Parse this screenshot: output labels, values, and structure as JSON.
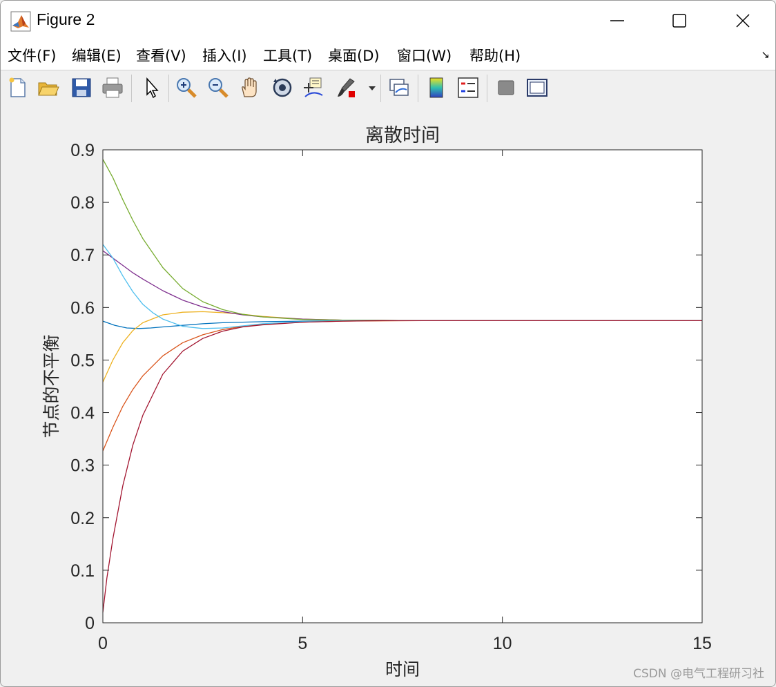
{
  "window": {
    "title": "Figure 2",
    "watermark": "CSDN @电气工程研习社"
  },
  "menu": [
    "文件(F)",
    "编辑(E)",
    "查看(V)",
    "插入(I)",
    "工具(T)",
    "桌面(D)",
    "窗口(W)",
    "帮助(H)"
  ],
  "toolbar": [
    "new-figure-icon",
    "open-file-icon",
    "save-icon",
    "print-icon",
    "pointer-icon",
    "zoom-in-icon",
    "zoom-out-icon",
    "pan-icon",
    "rotate-3d-icon",
    "data-cursor-icon",
    "brush-icon",
    "link-plot-icon",
    "colorbar-icon",
    "legend-icon",
    "hide-plot-tools-icon",
    "show-plot-tools-icon"
  ],
  "colors": {
    "blue": "#0072bd",
    "orange": "#d95319",
    "yellow": "#edb120",
    "purple": "#7e2f8e",
    "green": "#77ac30",
    "cyan": "#4dbeee",
    "darkred": "#a2142f"
  },
  "chart_data": {
    "type": "line",
    "title": "离散时间",
    "xlabel": "时间",
    "ylabel": "节点的不平衡",
    "xlim": [
      0,
      15
    ],
    "ylim": [
      0,
      0.9
    ],
    "xticks": [
      "0",
      "5",
      "10",
      "15"
    ],
    "yticks": [
      "0",
      "0.1",
      "0.2",
      "0.3",
      "0.4",
      "0.5",
      "0.6",
      "0.7",
      "0.8",
      "0.9"
    ],
    "grid": false,
    "series": [
      {
        "color": "#0072bd",
        "x": [
          0,
          0.3,
          0.6,
          0.9,
          1.2,
          1.5,
          2,
          2.5,
          3,
          4,
          5,
          6,
          8,
          10,
          15
        ],
        "y": [
          0.574,
          0.566,
          0.561,
          0.56,
          0.561,
          0.563,
          0.566,
          0.569,
          0.571,
          0.573,
          0.574,
          0.575,
          0.575,
          0.575,
          0.575
        ]
      },
      {
        "color": "#d95319",
        "x": [
          0,
          0.25,
          0.5,
          0.75,
          1,
          1.5,
          2,
          2.5,
          3,
          3.5,
          4,
          5,
          6,
          8,
          10,
          15
        ],
        "y": [
          0.327,
          0.372,
          0.412,
          0.444,
          0.47,
          0.508,
          0.533,
          0.548,
          0.558,
          0.564,
          0.568,
          0.572,
          0.574,
          0.575,
          0.575,
          0.575
        ]
      },
      {
        "color": "#edb120",
        "x": [
          0,
          0.25,
          0.5,
          0.75,
          1,
          1.5,
          2,
          2.5,
          3,
          3.5,
          4,
          5,
          6,
          8,
          10,
          15
        ],
        "y": [
          0.458,
          0.5,
          0.533,
          0.556,
          0.571,
          0.586,
          0.591,
          0.592,
          0.59,
          0.587,
          0.583,
          0.578,
          0.576,
          0.575,
          0.575,
          0.575
        ]
      },
      {
        "color": "#7e2f8e",
        "x": [
          0,
          0.25,
          0.5,
          0.75,
          1,
          1.5,
          2,
          2.5,
          3,
          3.5,
          4,
          5,
          6,
          8,
          10,
          15
        ],
        "y": [
          0.708,
          0.694,
          0.68,
          0.666,
          0.654,
          0.632,
          0.614,
          0.601,
          0.592,
          0.586,
          0.582,
          0.578,
          0.576,
          0.575,
          0.575,
          0.575
        ]
      },
      {
        "color": "#77ac30",
        "x": [
          0,
          0.25,
          0.5,
          0.75,
          1,
          1.5,
          2,
          2.5,
          3,
          3.5,
          4,
          5,
          6,
          8,
          10,
          15
        ],
        "y": [
          0.882,
          0.847,
          0.805,
          0.766,
          0.731,
          0.676,
          0.636,
          0.611,
          0.596,
          0.587,
          0.582,
          0.577,
          0.576,
          0.575,
          0.575,
          0.575
        ]
      },
      {
        "color": "#4dbeee",
        "x": [
          0,
          0.25,
          0.5,
          0.75,
          1,
          1.25,
          1.5,
          2,
          2.5,
          3,
          3.5,
          4,
          5,
          6,
          8,
          10,
          15
        ],
        "y": [
          0.72,
          0.694,
          0.66,
          0.63,
          0.606,
          0.59,
          0.578,
          0.564,
          0.56,
          0.561,
          0.565,
          0.569,
          0.573,
          0.575,
          0.575,
          0.575,
          0.575
        ]
      },
      {
        "color": "#a2142f",
        "x": [
          0,
          0.1,
          0.25,
          0.5,
          0.75,
          1,
          1.5,
          2,
          2.5,
          3,
          3.5,
          4,
          5,
          6,
          7,
          8,
          10,
          15
        ],
        "y": [
          0.02,
          0.085,
          0.16,
          0.261,
          0.338,
          0.395,
          0.473,
          0.517,
          0.541,
          0.555,
          0.563,
          0.567,
          0.572,
          0.574,
          0.575,
          0.575,
          0.575,
          0.575
        ]
      }
    ]
  }
}
